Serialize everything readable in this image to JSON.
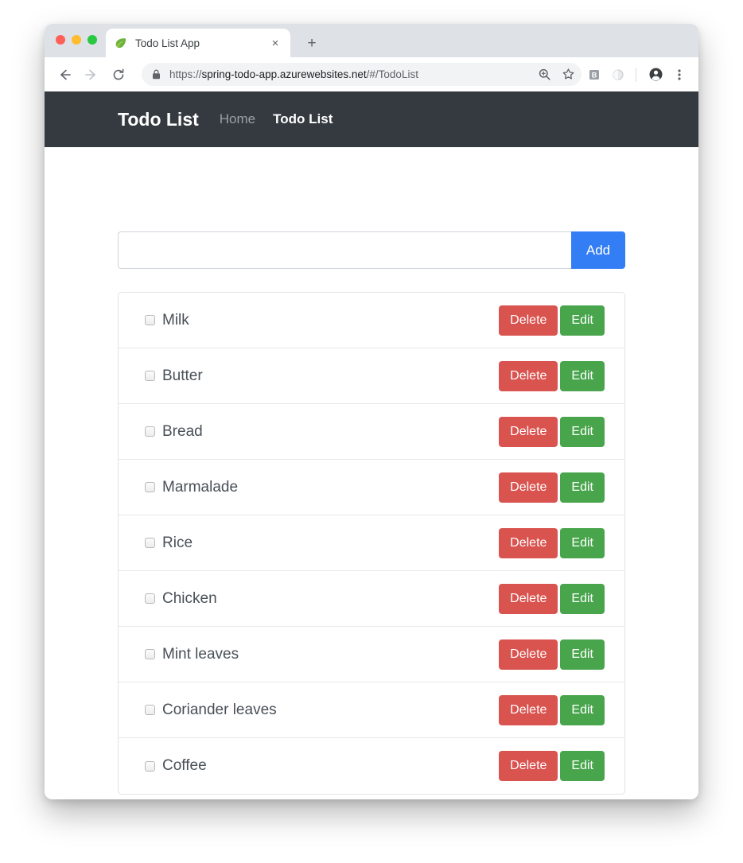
{
  "browser": {
    "tab": {
      "title": "Todo List App",
      "favicon": "leaf-icon",
      "close_label": "×"
    },
    "new_tab_label": "+",
    "nav": {
      "back": "back-arrow-icon",
      "forward": "forward-arrow-icon",
      "reload": "reload-icon"
    },
    "omnibox": {
      "lock": "lock-icon",
      "url_scheme": "https://",
      "url_host": "spring-todo-app.azurewebsites.net",
      "url_path": "/#/TodoList",
      "full_url": "https://spring-todo-app.azurewebsites.net/#/TodoList"
    },
    "toolbar_icons": [
      "zoom-in-icon",
      "bookmark-star-icon",
      "bitwarden-extension-icon",
      "extension-circle-icon",
      "profile-avatar-icon",
      "three-dot-menu-icon"
    ]
  },
  "navbar": {
    "brand": "Todo List",
    "links": [
      {
        "label": "Home",
        "active": false
      },
      {
        "label": "Todo List",
        "active": true
      }
    ],
    "background_color": "#343a40"
  },
  "add_form": {
    "input_value": "",
    "input_placeholder": "",
    "add_label": "Add",
    "add_color": "#337ef5"
  },
  "todo_list": {
    "delete_label": "Delete",
    "edit_label": "Edit",
    "delete_color": "#d9534f",
    "edit_color": "#48a54c",
    "items": [
      {
        "label": "Milk",
        "checked": false
      },
      {
        "label": "Butter",
        "checked": false
      },
      {
        "label": "Bread",
        "checked": false
      },
      {
        "label": "Marmalade",
        "checked": false
      },
      {
        "label": "Rice",
        "checked": false
      },
      {
        "label": "Chicken",
        "checked": false
      },
      {
        "label": "Mint leaves",
        "checked": false
      },
      {
        "label": "Coriander leaves",
        "checked": false
      },
      {
        "label": "Coffee",
        "checked": false
      }
    ]
  }
}
